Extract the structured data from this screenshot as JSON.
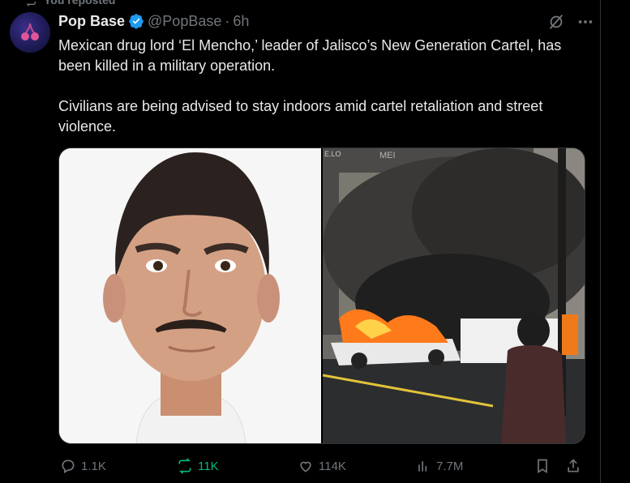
{
  "repost_banner": {
    "label": "You reposted",
    "icon": "repost-icon"
  },
  "author": {
    "name": "Pop Base",
    "handle": "@PopBase",
    "separator": "·",
    "time": "6h",
    "verified": true,
    "avatar_icon": "cherry-logo-icon"
  },
  "top_actions": {
    "grok_icon": "grok-icon",
    "more_icon": "more-icon"
  },
  "tweet": {
    "paragraphs": [
      "Mexican drug lord ‘El Mencho,’ leader of Jalisco’s New Generation Cartel, has been killed in a military operation.",
      "Civilians are being advised to stay indoors amid cartel retaliation and street violence."
    ]
  },
  "media": {
    "left": {
      "description_icon": "portrait-photo"
    },
    "right": {
      "sign_text": "MEI",
      "sign_text_2": "E.LO"
    }
  },
  "actions": {
    "reply": {
      "count": "1.1K",
      "icon": "reply-icon"
    },
    "repost": {
      "count": "11K",
      "icon": "repost-icon",
      "color": "#00ba7c"
    },
    "like": {
      "count": "114K",
      "icon": "heart-icon"
    },
    "views": {
      "count": "7.7M",
      "icon": "views-icon"
    },
    "bookmark": {
      "icon": "bookmark-icon"
    },
    "share": {
      "icon": "share-icon"
    }
  },
  "colors": {
    "background": "#000000",
    "text": "#e7e9ea",
    "muted": "#71767b",
    "verified": "#1d9bf0"
  }
}
